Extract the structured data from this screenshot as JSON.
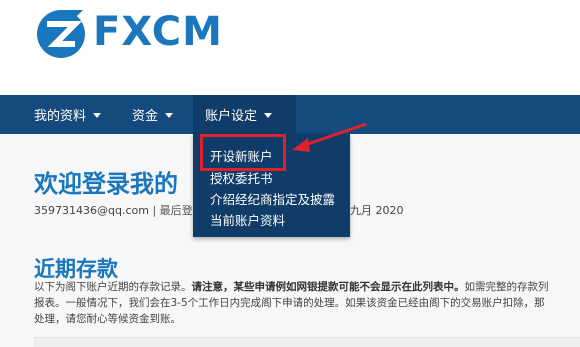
{
  "brand": {
    "name": "FXCM",
    "accent": "#1a76bd",
    "nav_bg": "#144a7e",
    "highlight": "#e0202a"
  },
  "nav": {
    "items": [
      {
        "label": "我的资料"
      },
      {
        "label": "资金"
      },
      {
        "label": "账户设定"
      }
    ]
  },
  "dropdown": {
    "items": [
      {
        "label": "开设新账户"
      },
      {
        "label": "授权委托书"
      },
      {
        "label": "介绍经纪商指定及披露"
      },
      {
        "label": "当前账户资料"
      }
    ]
  },
  "main": {
    "welcome": "欢迎登录我的",
    "email": "359731436@qq.com",
    "separator": "|",
    "last_login_label": "最后登",
    "last_login_date": "九月 2020",
    "section_title": "近期存款",
    "para_1": "以下为阁下账户近期的存款记录。",
    "para_bold": "请注意，某些申请例如网银提款可能不会显示在此列表中。",
    "para_2": "如需完整的存款列",
    "para_3": "报表。一般情况下，我们会在3-5个工作日内完成阁下申请的处理。如果该资金已经由阁下的交易账户扣除，那",
    "para_4": "处理，请您耐心等候资金到账。"
  }
}
